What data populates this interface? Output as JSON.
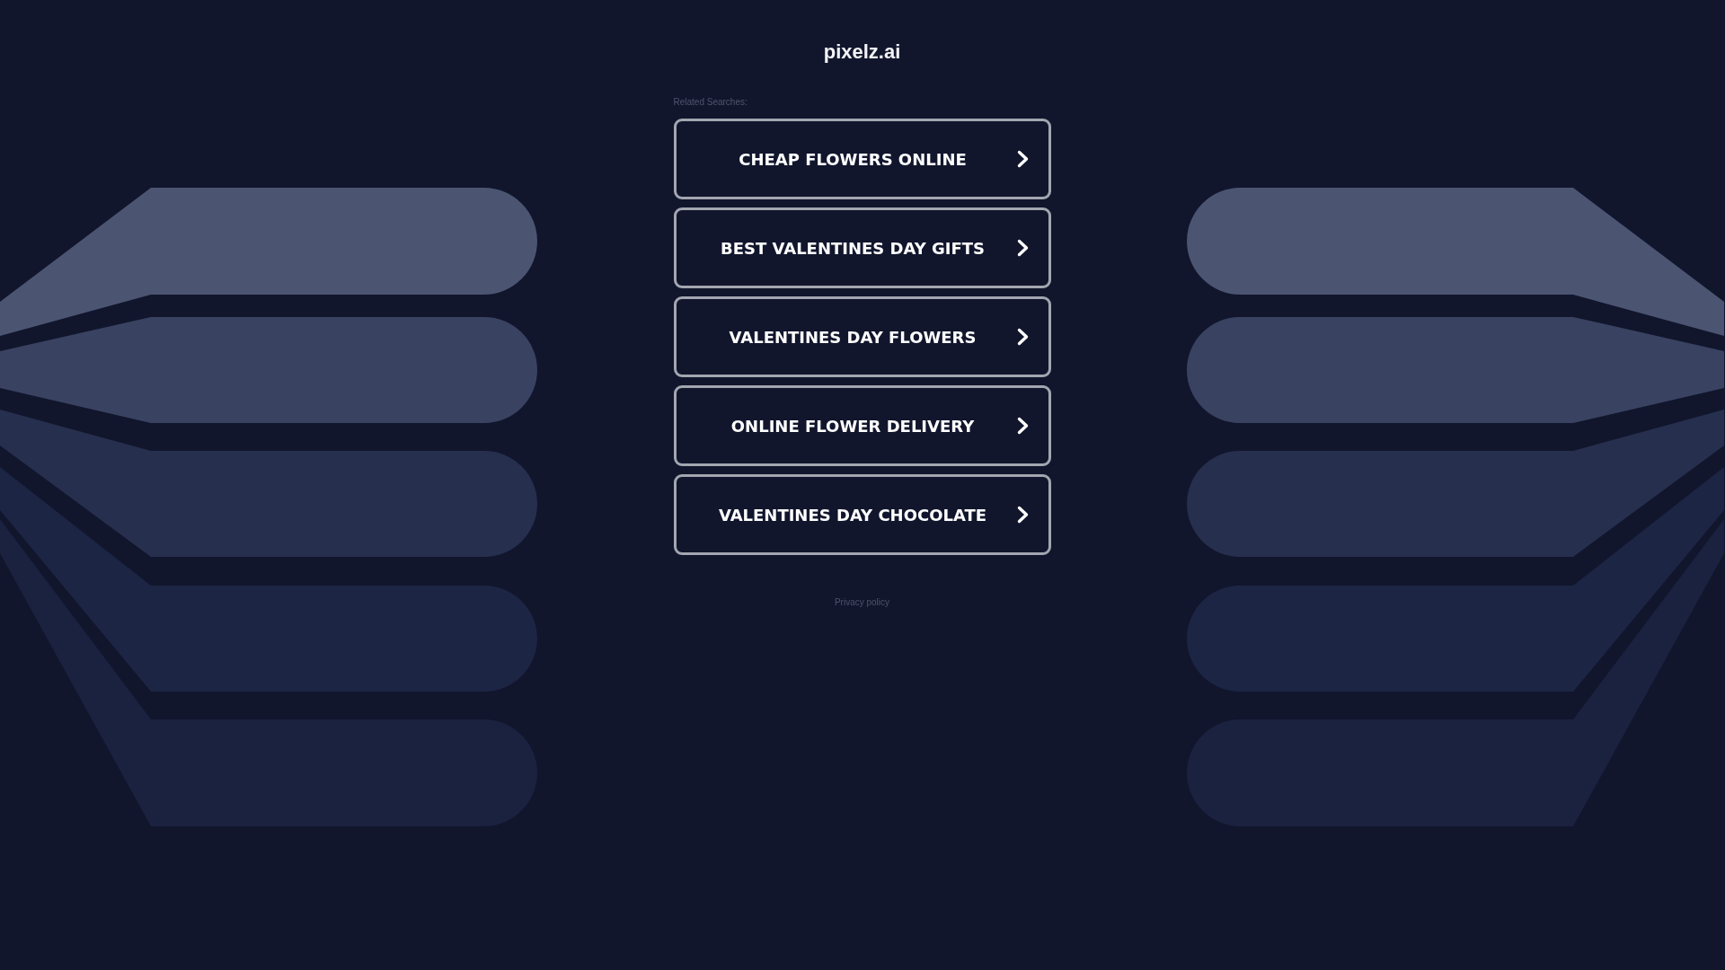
{
  "site_title": "pixelz.ai",
  "related_searches": {
    "heading": "Related Searches:",
    "items": [
      "CHEAP FLOWERS ONLINE",
      "BEST VALENTINES DAY GIFTS",
      "VALENTINES DAY FLOWERS",
      "ONLINE FLOWER DELIVERY",
      "VALENTINES DAY CHOCOLATE"
    ]
  },
  "footer": {
    "privacy_link": "Privacy policy"
  }
}
